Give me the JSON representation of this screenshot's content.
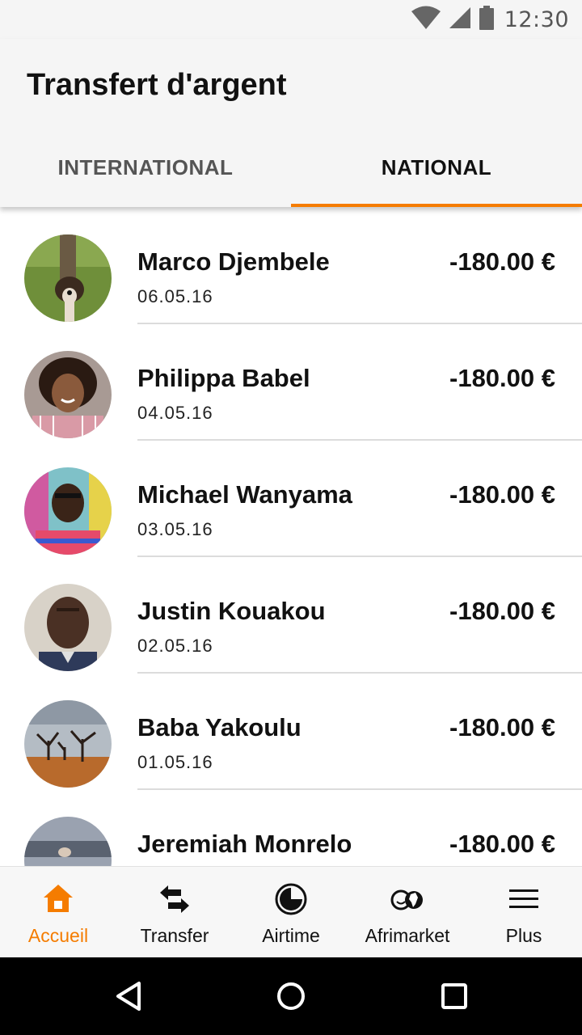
{
  "status_bar": {
    "time": "12:30"
  },
  "header": {
    "title": "Transfert d'argent"
  },
  "tabs": [
    {
      "label": "INTERNATIONAL",
      "active": false
    },
    {
      "label": "NATIONAL",
      "active": true
    }
  ],
  "transactions": [
    {
      "name": "Marco Djembele",
      "date": "06.05.16",
      "amount": "-180.00 €"
    },
    {
      "name": "Philippa Babel",
      "date": "04.05.16",
      "amount": "-180.00 €"
    },
    {
      "name": "Michael Wanyama",
      "date": "03.05.16",
      "amount": "-180.00 €"
    },
    {
      "name": "Justin Kouakou",
      "date": "02.05.16",
      "amount": "-180.00 €"
    },
    {
      "name": "Baba Yakoulu",
      "date": "01.05.16",
      "amount": "-180.00 €"
    },
    {
      "name": "Jeremiah Monrelo",
      "date": "",
      "amount": "-180.00 €"
    }
  ],
  "bottom_nav": [
    {
      "label": "Accueil",
      "icon": "home-icon",
      "active": true
    },
    {
      "label": "Transfer",
      "icon": "transfer-arrows-icon",
      "active": false
    },
    {
      "label": "Airtime",
      "icon": "airtime-clock-icon",
      "active": false
    },
    {
      "label": "Afrimarket",
      "icon": "afrimarket-globe-icon",
      "active": false
    },
    {
      "label": "Plus",
      "icon": "menu-icon",
      "active": false
    }
  ],
  "colors": {
    "accent": "#f57c00",
    "text": "#111111",
    "divider": "#dcdcdc"
  }
}
